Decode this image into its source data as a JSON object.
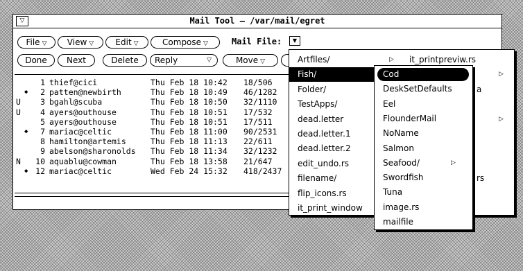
{
  "window": {
    "title": "Mail Tool  – /var/mail/egret"
  },
  "panel": {
    "row1": [
      {
        "label": "File",
        "has_menu": true
      },
      {
        "label": "View",
        "has_menu": true
      },
      {
        "label": "Edit",
        "has_menu": true
      },
      {
        "label": "Compose",
        "has_menu": true
      }
    ],
    "row2": [
      {
        "label": "Done",
        "has_menu": false
      },
      {
        "label": "Next",
        "has_menu": false
      },
      {
        "label": "Delete",
        "has_menu": false
      },
      {
        "label": "Reply",
        "has_menu": true
      },
      {
        "label": "Move",
        "has_menu": true
      }
    ],
    "mail_file_label": "Mail File:"
  },
  "messages": [
    {
      "status": "",
      "mark": "",
      "num": "1",
      "from": "thief@cici",
      "date": "Thu Feb 18 10:42",
      "size": "18/506"
    },
    {
      "status": "",
      "mark": "◆",
      "num": "2",
      "from": "patten@newbirth",
      "date": "Thu Feb 18 10:49",
      "size": "46/1282"
    },
    {
      "status": "U",
      "mark": "",
      "num": "3",
      "from": "bgahl@scuba",
      "date": "Thu Feb 18 10:50",
      "size": "32/1110"
    },
    {
      "status": "U",
      "mark": "",
      "num": "4",
      "from": "ayers@outhouse",
      "date": "Thu Feb 18 10:51",
      "size": "17/532"
    },
    {
      "status": "",
      "mark": "",
      "num": "5",
      "from": "ayers@outhouse",
      "date": "Thu Feb 18 10:51",
      "size": "17/511"
    },
    {
      "status": "",
      "mark": "◆",
      "num": "7",
      "from": "mariac@celtic",
      "date": "Thu Feb 18 11:00",
      "size": "90/2531"
    },
    {
      "status": "",
      "mark": "",
      "num": "8",
      "from": "hamilton@artemis",
      "date": "Thu Feb 18 11:13",
      "size": "22/611"
    },
    {
      "status": "",
      "mark": "",
      "num": "9",
      "from": "abelson@sharonolds",
      "date": "Thu Feb 18 11:34",
      "size": "32/1232"
    },
    {
      "status": "N",
      "mark": "",
      "num": "10",
      "from": "aquablu@cowman",
      "date": "Thu Feb 18 13:58",
      "size": "21/647"
    },
    {
      "status": "",
      "mark": "◆",
      "num": "12",
      "from": "mariac@celtic",
      "date": "Wed Feb 24 15:32",
      "size": "418/2437"
    }
  ],
  "menu_a": {
    "items": [
      {
        "label": "Artfiles/",
        "submenu": true,
        "selected": false
      },
      {
        "label": "Fish/",
        "submenu": true,
        "selected": true
      },
      {
        "label": "Folder/",
        "submenu": false,
        "selected": false
      },
      {
        "label": "TestApps/",
        "submenu": false,
        "selected": false
      },
      {
        "label": "dead.letter",
        "submenu": false,
        "selected": false
      },
      {
        "label": "dead.letter.1",
        "submenu": false,
        "selected": false
      },
      {
        "label": "dead.letter.2",
        "submenu": false,
        "selected": false
      },
      {
        "label": "edit_undo.rs",
        "submenu": false,
        "selected": false
      },
      {
        "label": "filename/",
        "submenu": false,
        "selected": false
      },
      {
        "label": "flip_icons.rs",
        "submenu": false,
        "selected": false
      },
      {
        "label": "it_print_window",
        "submenu": false,
        "selected": false
      }
    ],
    "right_column": [
      {
        "label": "it_printpreviw.rs",
        "submenu": true
      },
      {
        "label": "",
        "submenu": true
      },
      {
        "label": "a",
        "submenu": false
      },
      {
        "label": "",
        "submenu": true
      },
      {
        "label": "rs",
        "submenu": false
      }
    ]
  },
  "menu_b": {
    "items": [
      {
        "label": "Cod",
        "submenu": false,
        "selected": true
      },
      {
        "label": "DeskSetDefaults",
        "submenu": false,
        "selected": false
      },
      {
        "label": "Eel",
        "submenu": false,
        "selected": false
      },
      {
        "label": "FlounderMail",
        "submenu": false,
        "selected": false
      },
      {
        "label": "NoName",
        "submenu": false,
        "selected": false
      },
      {
        "label": "Salmon",
        "submenu": false,
        "selected": false
      },
      {
        "label": "Seafood/",
        "submenu": true,
        "selected": false
      },
      {
        "label": "Swordfish",
        "submenu": false,
        "selected": false
      },
      {
        "label": "Tuna",
        "submenu": false,
        "selected": false
      },
      {
        "label": "image.rs",
        "submenu": false,
        "selected": false
      },
      {
        "label": "mailfile",
        "submenu": false,
        "selected": false
      }
    ]
  }
}
